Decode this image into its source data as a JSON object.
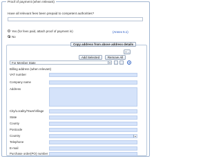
{
  "section": {
    "legend": "Proof of payment (when relevant)",
    "question": "Have all relevant fees been prepaid to competent authorities?",
    "options": [
      {
        "label": "Yes (for fees paid, attach proof of payment in)",
        "selected": false
      },
      {
        "label": "No",
        "selected": true
      }
    ],
    "annex_link": "(Annex 5.1)"
  },
  "toolbar": {
    "copy_button": "Copy address from above address details",
    "add_selected": "Add Selected",
    "remove_all": "Remove All",
    "member_state_selected": "For Member State",
    "help": "?",
    "plus": "+",
    "minus": "-"
  },
  "form": {
    "title": "Billing address (when relevant)",
    "fields": [
      {
        "label": "VAT number",
        "type": "input"
      },
      {
        "label": "Company name",
        "type": "input"
      },
      {
        "label": "Address",
        "type": "textarea"
      },
      {
        "label": "City/Locality/Town/Village",
        "type": "input"
      },
      {
        "label": "State",
        "type": "input"
      },
      {
        "label": "County",
        "type": "input"
      },
      {
        "label": "Postcode",
        "type": "input"
      },
      {
        "label": "Country",
        "type": "select"
      },
      {
        "label": "Telephone",
        "type": "input"
      },
      {
        "label": "E-mail",
        "type": "input"
      },
      {
        "label": "Purchase order(PO) number",
        "type": "input"
      }
    ]
  },
  "colors": {
    "field_fill": "#d5e3fa",
    "border": "#9fb4d0",
    "link": "#1a4fc0"
  }
}
